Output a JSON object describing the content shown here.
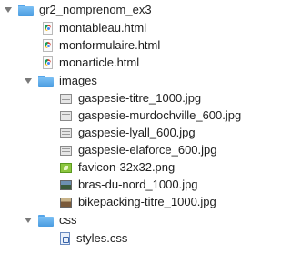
{
  "tree": {
    "root": {
      "name": "gr2_nomprenom_ex3",
      "icon": "folder-icon"
    },
    "files": [
      {
        "name": "montableau.html",
        "icon": "chrome-html-icon"
      },
      {
        "name": "monformulaire.html",
        "icon": "chrome-html-icon"
      },
      {
        "name": "monarticle.html",
        "icon": "chrome-html-icon"
      }
    ],
    "images_folder": {
      "name": "images",
      "icon": "folder-icon",
      "items": [
        {
          "name": "gaspesie-titre_1000.jpg",
          "icon": "image-file-icon"
        },
        {
          "name": "gaspesie-murdochville_600.jpg",
          "icon": "image-file-icon"
        },
        {
          "name": "gaspesie-lyall_600.jpg",
          "icon": "image-file-icon"
        },
        {
          "name": "gaspesie-elaforce_600.jpg",
          "icon": "image-file-icon"
        },
        {
          "name": "favicon-32x32.png",
          "icon": "png-file-icon"
        },
        {
          "name": "bras-du-nord_1000.jpg",
          "icon": "photo-file-icon"
        },
        {
          "name": "bikepacking-titre_1000.jpg",
          "icon": "photo-file-icon"
        }
      ]
    },
    "css_folder": {
      "name": "css",
      "icon": "folder-icon",
      "items": [
        {
          "name": "styles.css",
          "icon": "css-file-icon"
        }
      ]
    }
  },
  "colors": {
    "folder": "#4a9be0",
    "text": "#1e1e1e",
    "chevron": "#7a7a7a"
  }
}
